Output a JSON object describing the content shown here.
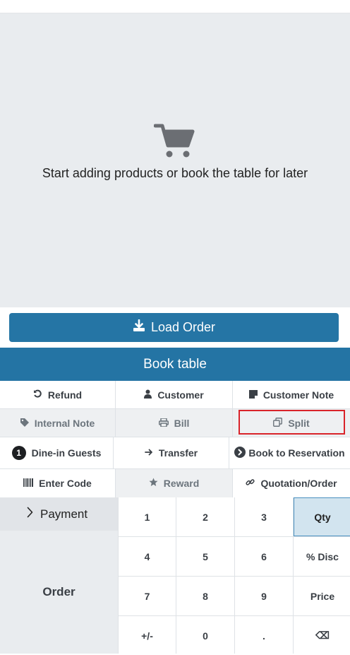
{
  "empty_state": {
    "message": "Start adding products or book the table for later",
    "icon": "cart-icon"
  },
  "load_order": {
    "label": "Load Order",
    "icon": "download-icon"
  },
  "book_table": {
    "label": "Book table"
  },
  "actions_row1": [
    {
      "label": "Refund",
      "icon": "undo-icon"
    },
    {
      "label": "Customer",
      "icon": "user-icon"
    },
    {
      "label": "Customer Note",
      "icon": "sticky-note-icon"
    }
  ],
  "actions_row2": [
    {
      "label": "Internal Note",
      "icon": "tag-icon"
    },
    {
      "label": "Bill",
      "icon": "print-icon"
    },
    {
      "label": "Split",
      "icon": "clone-icon"
    }
  ],
  "actions_row3": [
    {
      "label": "Dine-in Guests",
      "badge": "1"
    },
    {
      "label": "Transfer",
      "icon": "arrow-right-icon"
    },
    {
      "label": "Book to Reservation",
      "icon": "chevron-circle-right-icon"
    }
  ],
  "actions_row4": [
    {
      "label": "Enter Code",
      "icon": "barcode-icon"
    },
    {
      "label": "Reward",
      "icon": "star-icon"
    },
    {
      "label": "Quotation/Order",
      "icon": "link-icon"
    }
  ],
  "payment": {
    "label": "Payment",
    "icon": "chevron-right-icon"
  },
  "order": {
    "label": "Order"
  },
  "numpad": [
    "1",
    "2",
    "3",
    "Qty",
    "4",
    "5",
    "6",
    "% Disc",
    "7",
    "8",
    "9",
    "Price",
    "+/-",
    "0",
    ".",
    "⌫"
  ],
  "numpad_selected": "Qty",
  "colors": {
    "primary": "#2474a4",
    "highlight": "#d9232a"
  }
}
